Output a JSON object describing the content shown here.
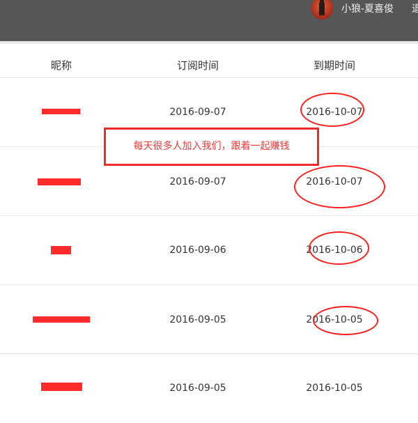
{
  "topbar": {
    "username": "小狼-夏喜俊",
    "logout_label": "退"
  },
  "table": {
    "headers": {
      "nickname": "昵称",
      "subscribe_time": "订阅时间",
      "expire_time": "到期时间"
    },
    "rows": [
      {
        "subscribe": "2016-09-07",
        "expire": "2016-10-07"
      },
      {
        "subscribe": "2016-09-07",
        "expire": "2016-10-07"
      },
      {
        "subscribe": "2016-09-06",
        "expire": "2016-10-06"
      },
      {
        "subscribe": "2016-09-05",
        "expire": "2016-10-05"
      },
      {
        "subscribe": "2016-09-05",
        "expire": "2016-10-05"
      }
    ]
  },
  "annotation": {
    "banner_text": "每天很多人加入我们，跟着一起赚钱"
  },
  "colors": {
    "topbar_bg": "#565656",
    "annotation_red": "#ff1f1f",
    "row_border": "#e6e6e6"
  }
}
